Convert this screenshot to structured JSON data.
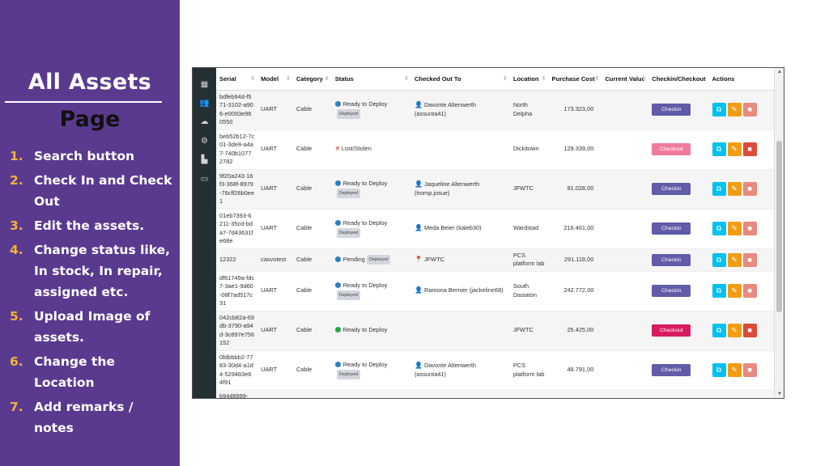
{
  "slide": {
    "title_line1": "All Assets",
    "title_line2": "Page",
    "features": [
      {
        "num": "1.",
        "text": "Search button"
      },
      {
        "num": "2.",
        "text": "Check In and Check Out"
      },
      {
        "num": "3.",
        "text": "Edit the assets."
      },
      {
        "num": "4.",
        "text": "Change status like, In stock, In repair, assigned etc."
      },
      {
        "num": "5.",
        "text": "Upload Image of assets."
      },
      {
        "num": "6.",
        "text": "Change the Location"
      },
      {
        "num": "7.",
        "text": "Add remarks / notes"
      }
    ]
  },
  "table": {
    "columns": [
      "Serial",
      "Model",
      "Category",
      "Status",
      "Checked Out To",
      "Location",
      "Purchase Cost",
      "Current Value",
      "Checkin/Checkout",
      "Actions"
    ],
    "rows": [
      {
        "serial": "bdfeb94d-f571-3102-a906-e0093e960550",
        "model": "UART",
        "category": "Cable",
        "status": "Ready to Deploy",
        "badge": "Deployed",
        "checked_out_to": "Davonte Altenwerth (assunta41)",
        "location": "North Delpha",
        "purchase_cost": "173.323,00",
        "current_value": "",
        "check_label": "Checkin"
      },
      {
        "serial": "beb52b12-7c01-3de8-a4a7-740b10772782",
        "model": "UART",
        "category": "Cable",
        "status": "Lost/Stolen",
        "badge": "",
        "checked_out_to": "",
        "location": "Dickitown",
        "purchase_cost": "129.339,00",
        "current_value": "",
        "check_label": "Checkout"
      },
      {
        "serial": "9f20a243-16f3-368f-8979-76cff26b0ee1",
        "model": "UART",
        "category": "Cable",
        "status": "Ready to Deploy",
        "badge": "Deployed",
        "checked_out_to": "Jaqueline Altenwerth (tromp.josue)",
        "location": "JFWTC",
        "purchase_cost": "91.028,00",
        "current_value": "",
        "check_label": "Checkin"
      },
      {
        "serial": "01eb7393-6211-35cd-bda7-7d43631fe68e",
        "model": "UART",
        "category": "Cable",
        "status": "Ready to Deploy",
        "badge": "Deployed",
        "checked_out_to": "Meda Beier (kaleb30)",
        "location": "Wardstad",
        "purchase_cost": "216.461,00",
        "current_value": "",
        "check_label": "Checkin"
      },
      {
        "serial": "12322",
        "model": "casvotest",
        "category": "Cable",
        "status": "Pending",
        "badge": "Deployed",
        "checked_out_to": "JFWTC",
        "location": "PCS platform lab",
        "purchase_cost": "291.118,00",
        "current_value": "",
        "check_label": "Checkin"
      },
      {
        "serial": "df61749a-fdc7-3ae1-9d60-08f7ad517c31",
        "model": "UART",
        "category": "Cable",
        "status": "Ready to Deploy",
        "badge": "Deployed",
        "checked_out_to": "Ramona Bernier (jackeline68)",
        "location": "South Dasiaton",
        "purchase_cost": "242.772,00",
        "current_value": "",
        "check_label": "Checkin"
      },
      {
        "serial": "042cb82a-69db-3790-a94d-3c897e756152",
        "model": "UART",
        "category": "Cable",
        "status": "Ready to Deploy",
        "badge": "",
        "checked_out_to": "",
        "location": "JFWTC",
        "purchase_cost": "25.425,00",
        "current_value": "",
        "check_label": "Checkout"
      },
      {
        "serial": "0fdbbbb2-7783-30d4-a1d4-529483e64f91",
        "model": "UART",
        "category": "Cable",
        "status": "Ready to Deploy",
        "badge": "Deployed",
        "checked_out_to": "Davonte Altenwerth (assunta41)",
        "location": "PCS platform lab",
        "purchase_cost": "48.791,00",
        "current_value": "",
        "check_label": "Checkin"
      },
      {
        "serial": "b94d8999-",
        "model": "",
        "category": "",
        "status": "",
        "badge": "",
        "checked_out_to": "",
        "location": "",
        "purchase_cost": "",
        "current_value": "",
        "check_label": ""
      }
    ]
  },
  "sidebar_icons": [
    "barcode-icon",
    "users-icon",
    "cloud-icon",
    "gear-icon",
    "chart-icon",
    "laptop-icon"
  ],
  "colors": {
    "slide_panel": "#5a3a8f",
    "list_numbers": "#f3b23a",
    "sidebar": "#253035",
    "checkin_button": "#605ca8",
    "checkout_button_light": "#ef7b9f",
    "checkout_button_strong": "#d81b60",
    "clone_button": "#00c0ef",
    "edit_button": "#f39c12",
    "delete_button": "#dd4b39"
  }
}
